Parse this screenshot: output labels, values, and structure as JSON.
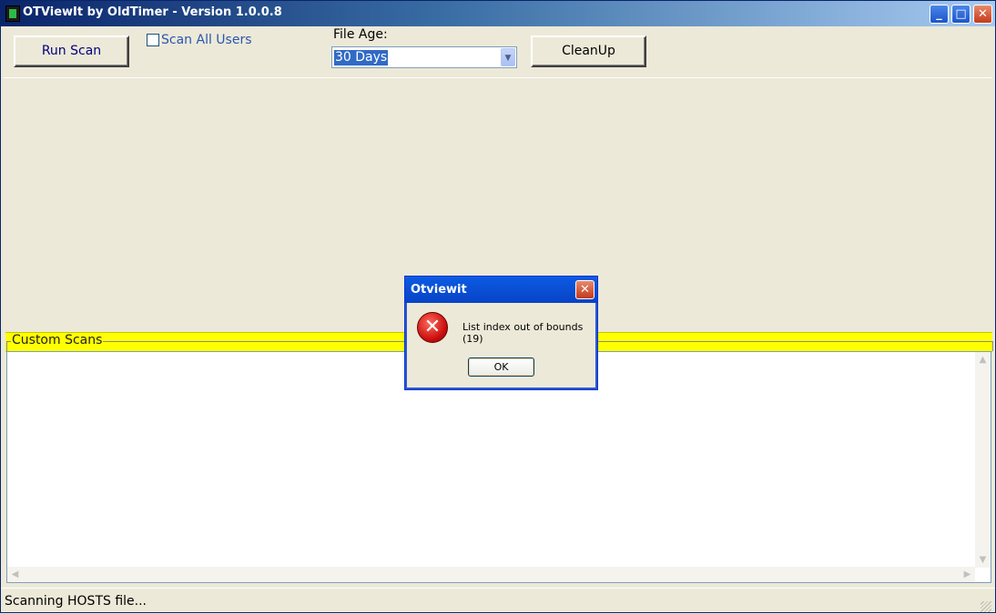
{
  "window": {
    "title": "OTViewIt by OldTimer - Version 1.0.0.8"
  },
  "toolbar": {
    "run_scan_label": "Run Scan",
    "scan_all_users_label": "Scan All Users",
    "scan_all_users_checked": false,
    "file_age_label": "File Age:",
    "file_age_value": "30 Days",
    "cleanup_label": "CleanUp"
  },
  "custom_scans": {
    "label": "Custom Scans"
  },
  "status": {
    "text": "Scanning HOSTS file..."
  },
  "dialog": {
    "title": "Otviewit",
    "message": "List index out of bounds (19)",
    "ok_label": "OK",
    "icon": "error-icon"
  },
  "colors": {
    "accent_yellow": "#ffff00",
    "title_blue": "#0a246a",
    "link_blue": "#000080"
  }
}
